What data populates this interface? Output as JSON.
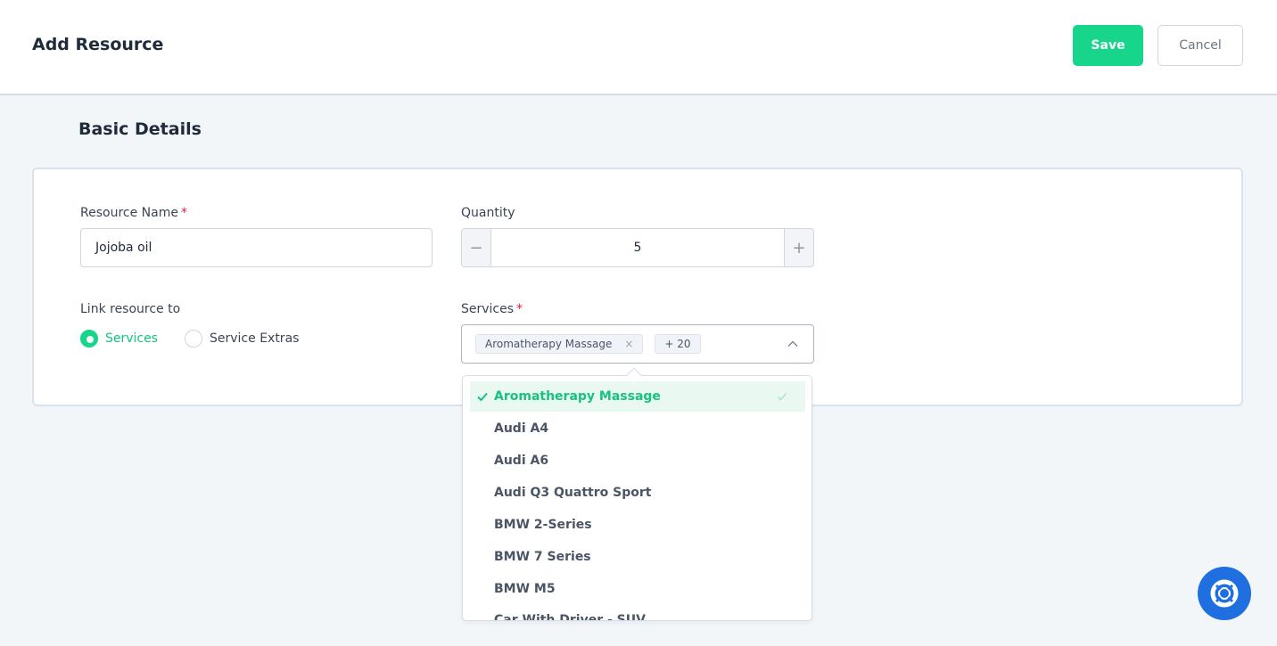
{
  "header": {
    "title": "Add Resource",
    "save_label": "Save",
    "cancel_label": "Cancel"
  },
  "section": {
    "title": "Basic Details"
  },
  "form": {
    "resource_name": {
      "label": "Resource Name",
      "required_mark": "*",
      "value": "Jojoba oil"
    },
    "quantity": {
      "label": "Quantity",
      "value": "5",
      "minus": "−",
      "plus": "+"
    },
    "link_resource": {
      "label": "Link resource to",
      "options": [
        "Services",
        "Service Extras"
      ],
      "selected": "Services"
    },
    "services": {
      "label": "Services",
      "required_mark": "*",
      "tags": [
        "Aromatherapy Massage"
      ],
      "more_count": "+ 20",
      "tag_remove": "×"
    }
  },
  "dropdown": {
    "options": [
      {
        "label": "Aromatherapy Massage",
        "selected": true
      },
      {
        "label": "Audi A4",
        "selected": false
      },
      {
        "label": "Audi A6",
        "selected": false
      },
      {
        "label": "Audi Q3 Quattro Sport",
        "selected": false
      },
      {
        "label": "BMW 2-Series",
        "selected": false
      },
      {
        "label": "BMW 7 Series",
        "selected": false
      },
      {
        "label": "BMW M5",
        "selected": false
      },
      {
        "label": "Car With Driver - SUV",
        "selected": false
      }
    ]
  },
  "colors": {
    "accent": "#17d58a",
    "help_button": "#1f6fe0"
  },
  "icons": {
    "help": "lifebuoy-icon",
    "collapse": "chevron-up-icon",
    "check": "check-icon"
  }
}
